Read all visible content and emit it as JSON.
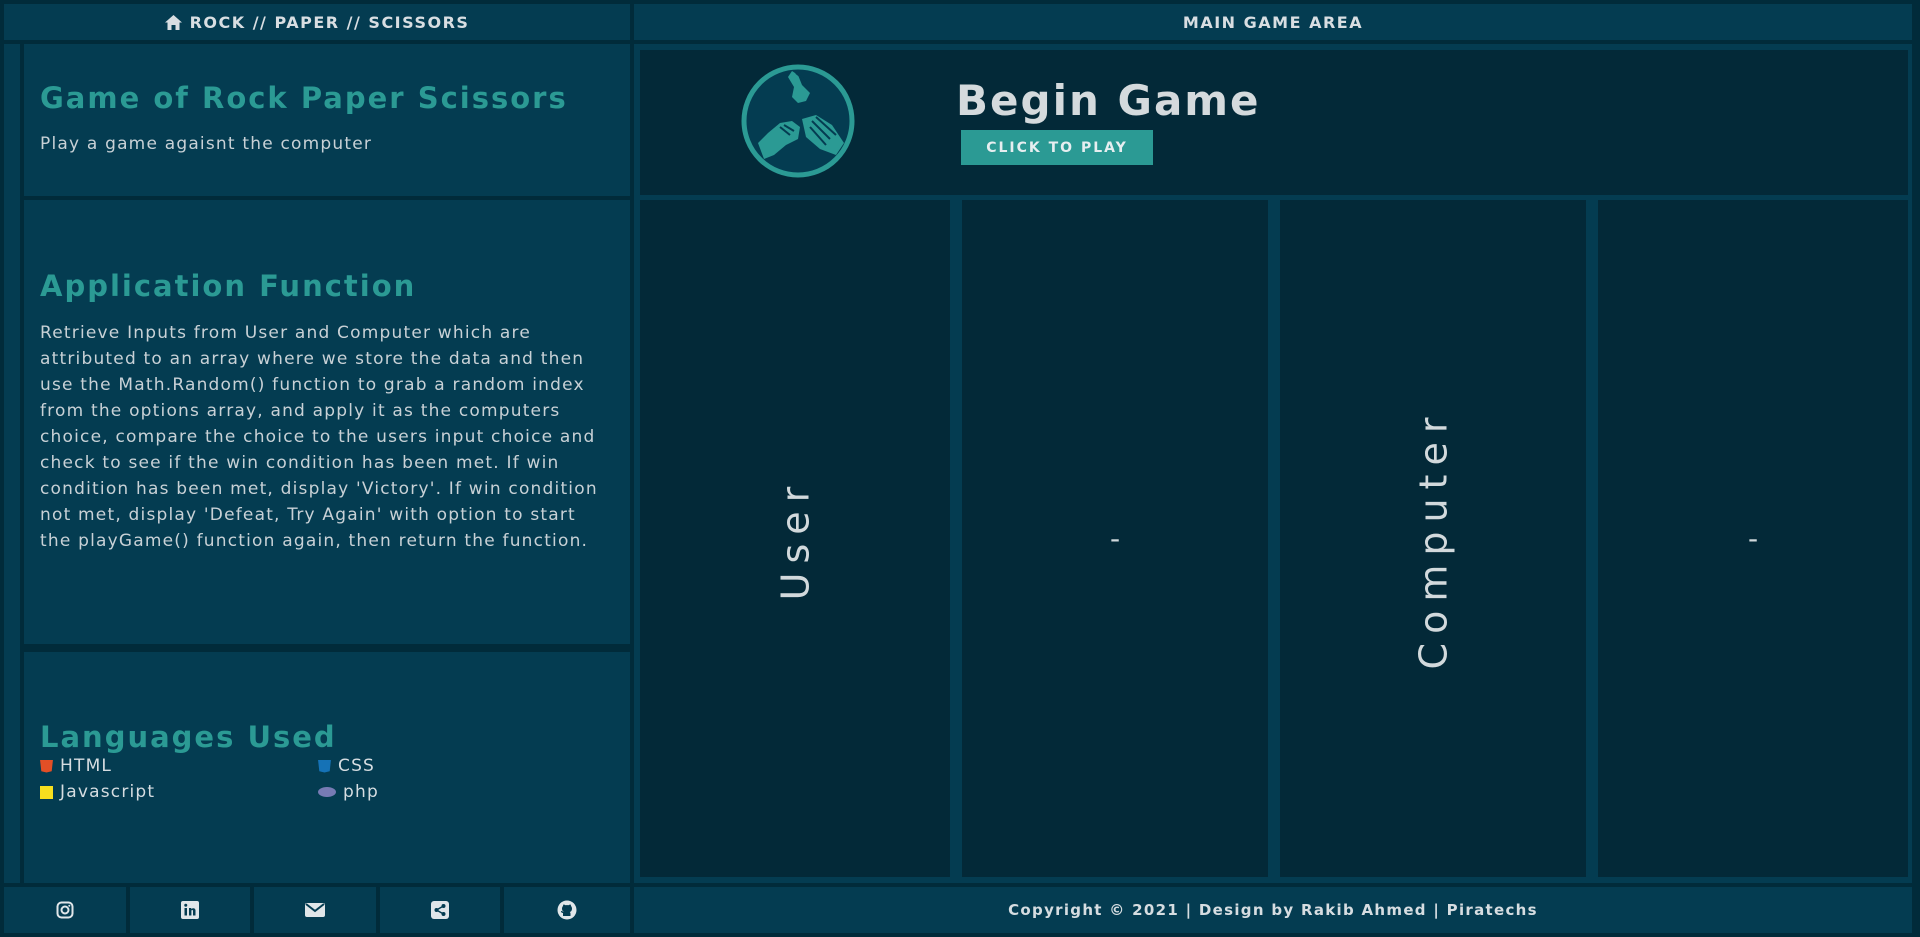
{
  "header": {
    "left_title": "ROCK // PAPER // SCISSORS",
    "right_title": "MAIN GAME AREA"
  },
  "intro": {
    "title": "Game of Rock Paper Scissors",
    "subtitle": "Play a game agaisnt the computer"
  },
  "function": {
    "title": "Application Function",
    "text": "Retrieve Inputs from User and Computer which are attributed to an array where we store the data and then use the Math.Random() function to grab a random index from the options array, and apply it as the computers choice, compare the choice to the users input choice and check to see if the win condition has been met. If win condition has been met, display 'Victory'. If win condition not met, display 'Defeat, Try Again' with option to start the playGame() function again, then return the function."
  },
  "languages": {
    "title": "Languages Used",
    "items": [
      {
        "label": "HTML",
        "icon": "html5-icon",
        "color": "#e34f26"
      },
      {
        "label": "CSS",
        "icon": "css3-icon",
        "color": "#1572b6"
      },
      {
        "label": "Javascript",
        "icon": "js-icon",
        "color": "#f7df1e"
      },
      {
        "label": "php",
        "icon": "php-icon",
        "color": "#777bb4"
      }
    ]
  },
  "game": {
    "title": "Begin Game",
    "play_label": "CLICK TO PLAY",
    "user_label": "User",
    "user_choice": "-",
    "computer_label": "Computer",
    "computer_choice": "-"
  },
  "footer": {
    "social": [
      "instagram-icon",
      "linkedin-icon",
      "email-icon",
      "share-icon",
      "github-icon"
    ],
    "copyright": "Copyright © 2021 | Design by Rakib Ahmed | Piratechs"
  },
  "colors": {
    "accent": "#2b9a94",
    "panel": "#043c51",
    "background": "#012b3a",
    "dark_panel": "#032938"
  }
}
